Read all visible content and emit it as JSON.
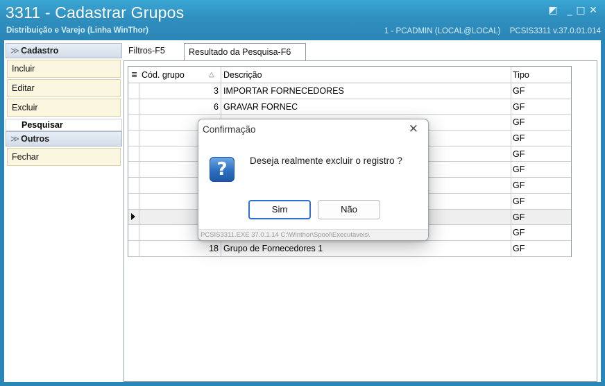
{
  "window": {
    "title": "3311 - Cadastrar Grupos",
    "subtitle": "Distribuição e Varejo (Linha WinThor)",
    "session": "1 - PCADMIN (LOCAL@LOCAL)",
    "module": "PCSIS3311  v.37.0.01.014",
    "controls": {
      "restore": "◩",
      "minimize": "_",
      "maximize": "□",
      "close": "✕"
    }
  },
  "sidebar": {
    "cadastro_header": "Cadastro",
    "cadastro_items": [
      "Incluir",
      "Editar",
      "Excluir"
    ],
    "pesquisar_label": "Pesquisar",
    "outros_header": "Outros",
    "outros_items": [
      "Fechar"
    ]
  },
  "tabs": [
    "Filtros-F5",
    "Resultado da Pesquisa-F6"
  ],
  "grid": {
    "columns": [
      "Cód. grupo",
      "Descrição",
      "Tipo"
    ],
    "rows": [
      {
        "cod": "3",
        "desc": "IMPORTAR FORNECEDORES",
        "tipo": "GF"
      },
      {
        "cod": "6",
        "desc": "GRAVAR FORNEC",
        "tipo": "GF"
      },
      {
        "cod": "",
        "desc": "",
        "tipo": "GF"
      },
      {
        "cod": "",
        "desc": "",
        "tipo": "GF"
      },
      {
        "cod": "",
        "desc": "",
        "tipo": "GF"
      },
      {
        "cod": "",
        "desc": "",
        "tipo": "GF"
      },
      {
        "cod": "",
        "desc": "",
        "tipo": "GF"
      },
      {
        "cod": "",
        "desc": "",
        "tipo": "GF"
      },
      {
        "cod": "",
        "desc": "",
        "tipo": "GF"
      },
      {
        "cod": "",
        "desc": "",
        "tipo": "GF"
      },
      {
        "cod": "18",
        "desc": "Grupo  de Fornecedores 1",
        "tipo": "GF"
      }
    ]
  },
  "dialog": {
    "title": "Confirmação",
    "close": "✕",
    "icon": "?",
    "message": "Deseja realmente excluir o registro ?",
    "yes": "Sim",
    "no": "Não",
    "footer": "PCSIS3311.EXE 37.0.1.14 C:\\Winthor\\Spool\\Executaveis\\"
  }
}
